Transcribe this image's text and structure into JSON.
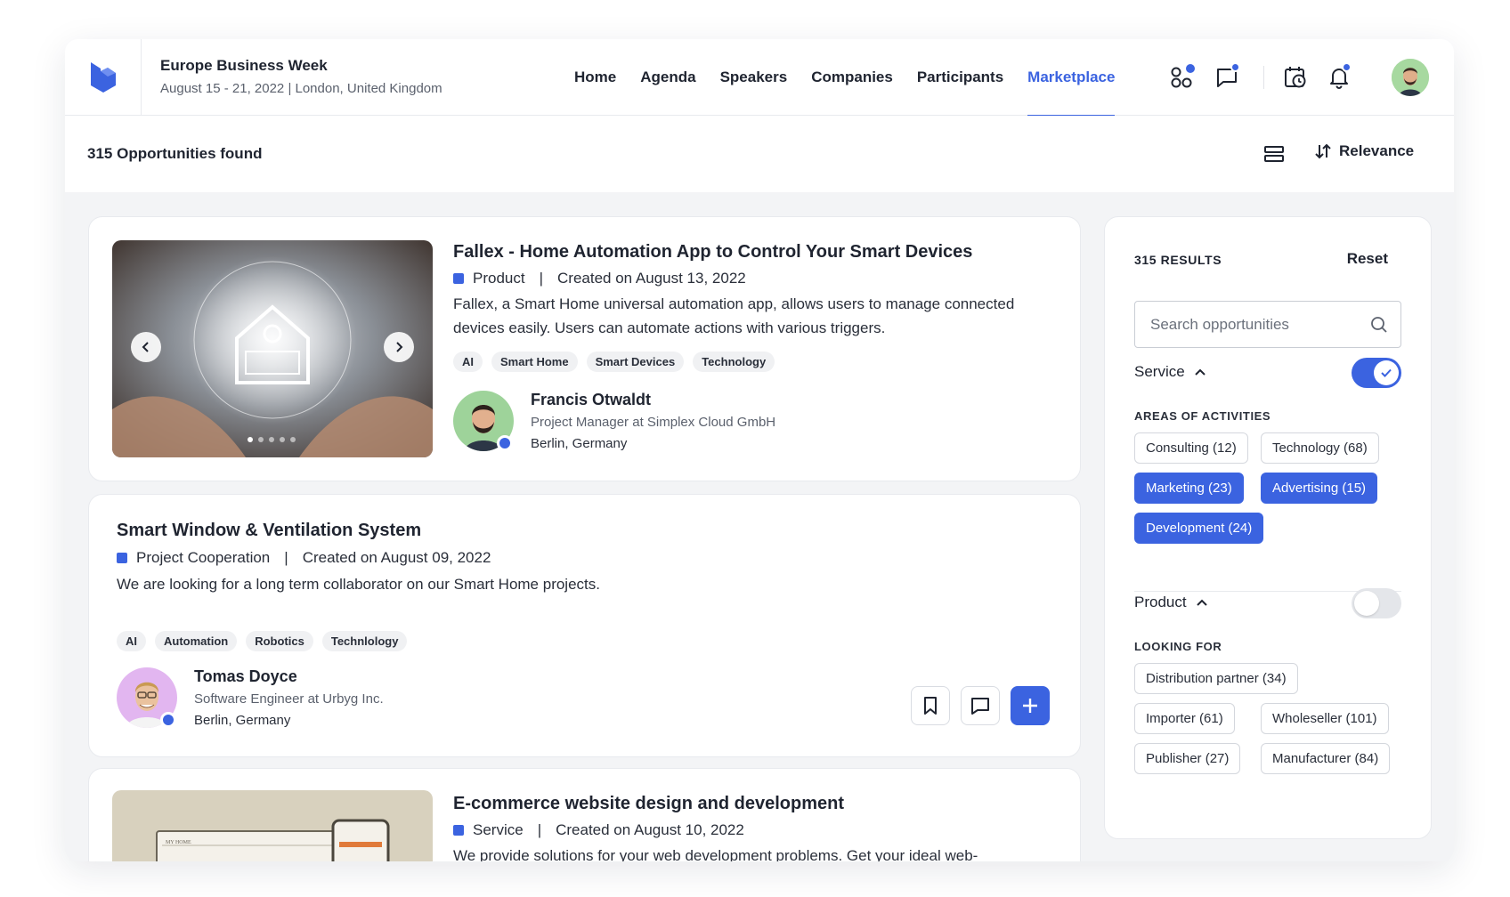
{
  "event": {
    "title": "Europe Business Week",
    "subtitle": "August 15 - 21, 2022 | London, United Kingdom"
  },
  "nav": {
    "items": [
      {
        "label": "Home"
      },
      {
        "label": "Agenda"
      },
      {
        "label": "Speakers"
      },
      {
        "label": "Companies"
      },
      {
        "label": "Participants"
      },
      {
        "label": "Marketplace",
        "active": true
      }
    ]
  },
  "header_icons": [
    "apps-icon",
    "chat-icon",
    "calendar-clock-icon",
    "bell-icon"
  ],
  "results_bar": {
    "count": "315",
    "label": " Opportunities found",
    "sort_label": "Relevance"
  },
  "cards": [
    {
      "title": "Fallex - Home Automation App to Control Your Smart Devices",
      "type": "Product",
      "created": "Created on August 13, 2022",
      "description": "Fallex, a Smart Home universal automation app, allows users to manage connected devices easily. Users can automate actions with various triggers.",
      "tags": [
        "AI",
        "Smart Home",
        "Smart Devices",
        "Technology"
      ],
      "person": {
        "name": "Francis Otwaldt",
        "role": "Project Manager at Simplex Cloud GmbH",
        "location": "Berlin, Germany"
      }
    },
    {
      "title": "Smart Window & Ventilation System",
      "type": "Project Cooperation",
      "created": "Created on August 09, 2022",
      "description": "We are looking for a long term collaborator on our Smart Home projects.",
      "tags": [
        "AI",
        "Automation",
        "Robotics",
        "Technlology"
      ],
      "person": {
        "name": "Tomas Doyce",
        "role": "Software Engineer at Urbyg Inc.",
        "location": "Berlin, Germany"
      }
    },
    {
      "title": "E-commerce website design and development",
      "type": "Service",
      "created": "Created on August 10, 2022",
      "description": "We provide solutions for your web development problems. Get your ideal web-",
      "thumb_text": "MY HOME"
    }
  ],
  "filters": {
    "results_label": "315 RESULTS",
    "reset_label": "Reset",
    "search_placeholder": "Search opportunities",
    "service": {
      "label": "Service",
      "enabled": true,
      "section_label": "AREAS OF ACTIVITIES",
      "chips": [
        {
          "label": "Consulting (12)",
          "selected": false
        },
        {
          "label": "Technology (68)",
          "selected": false
        },
        {
          "label": "Marketing (23)",
          "selected": true
        },
        {
          "label": "Advertising (15)",
          "selected": true
        },
        {
          "label": "Development (24)",
          "selected": true
        }
      ]
    },
    "product": {
      "label": "Product",
      "enabled": false,
      "section_label": "LOOKING FOR",
      "chips": [
        {
          "label": "Distribution partner (34)",
          "selected": false
        },
        {
          "label": "Importer (61)",
          "selected": false
        },
        {
          "label": "Wholeseller (101)",
          "selected": false
        },
        {
          "label": "Publisher (27)",
          "selected": false
        },
        {
          "label": "Manufacturer (84)",
          "selected": false
        }
      ]
    }
  },
  "colors": {
    "accent": "#3b63e0",
    "text": "#1f2430",
    "muted": "#5b616d",
    "panel_bg": "#f3f4f6"
  }
}
